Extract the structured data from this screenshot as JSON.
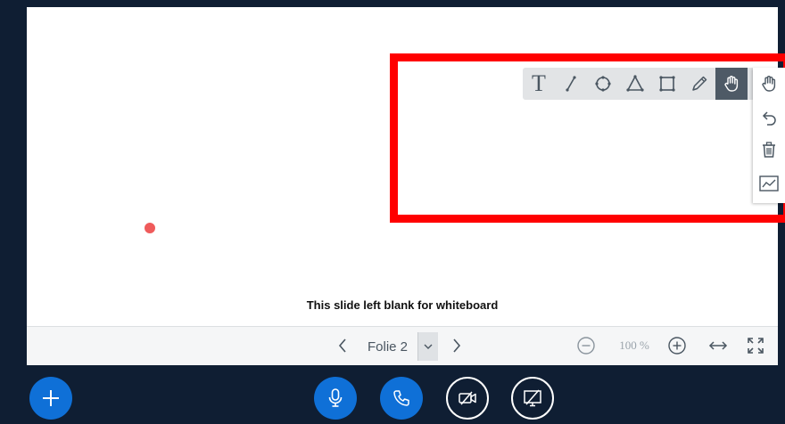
{
  "slide": {
    "caption": "This slide left blank for whiteboard"
  },
  "whiteboard_toolbar": {
    "tools": [
      "text",
      "line",
      "ellipse",
      "triangle",
      "rectangle",
      "pencil",
      "pan"
    ],
    "active_tool": "pan",
    "side_tools": [
      "pan",
      "undo",
      "clear-all",
      "multi-user"
    ]
  },
  "presentation_bar": {
    "slide_label": "Folie 2",
    "zoom_value": "100 %"
  },
  "actions": {
    "buttons": [
      "plus",
      "microphone",
      "phone",
      "video-off",
      "screenshare-off"
    ]
  },
  "colors": {
    "background": "#0f1e33",
    "highlight": "#ff0000",
    "primary_blue": "#0f70d7",
    "cursor": "#ef5b5b"
  }
}
